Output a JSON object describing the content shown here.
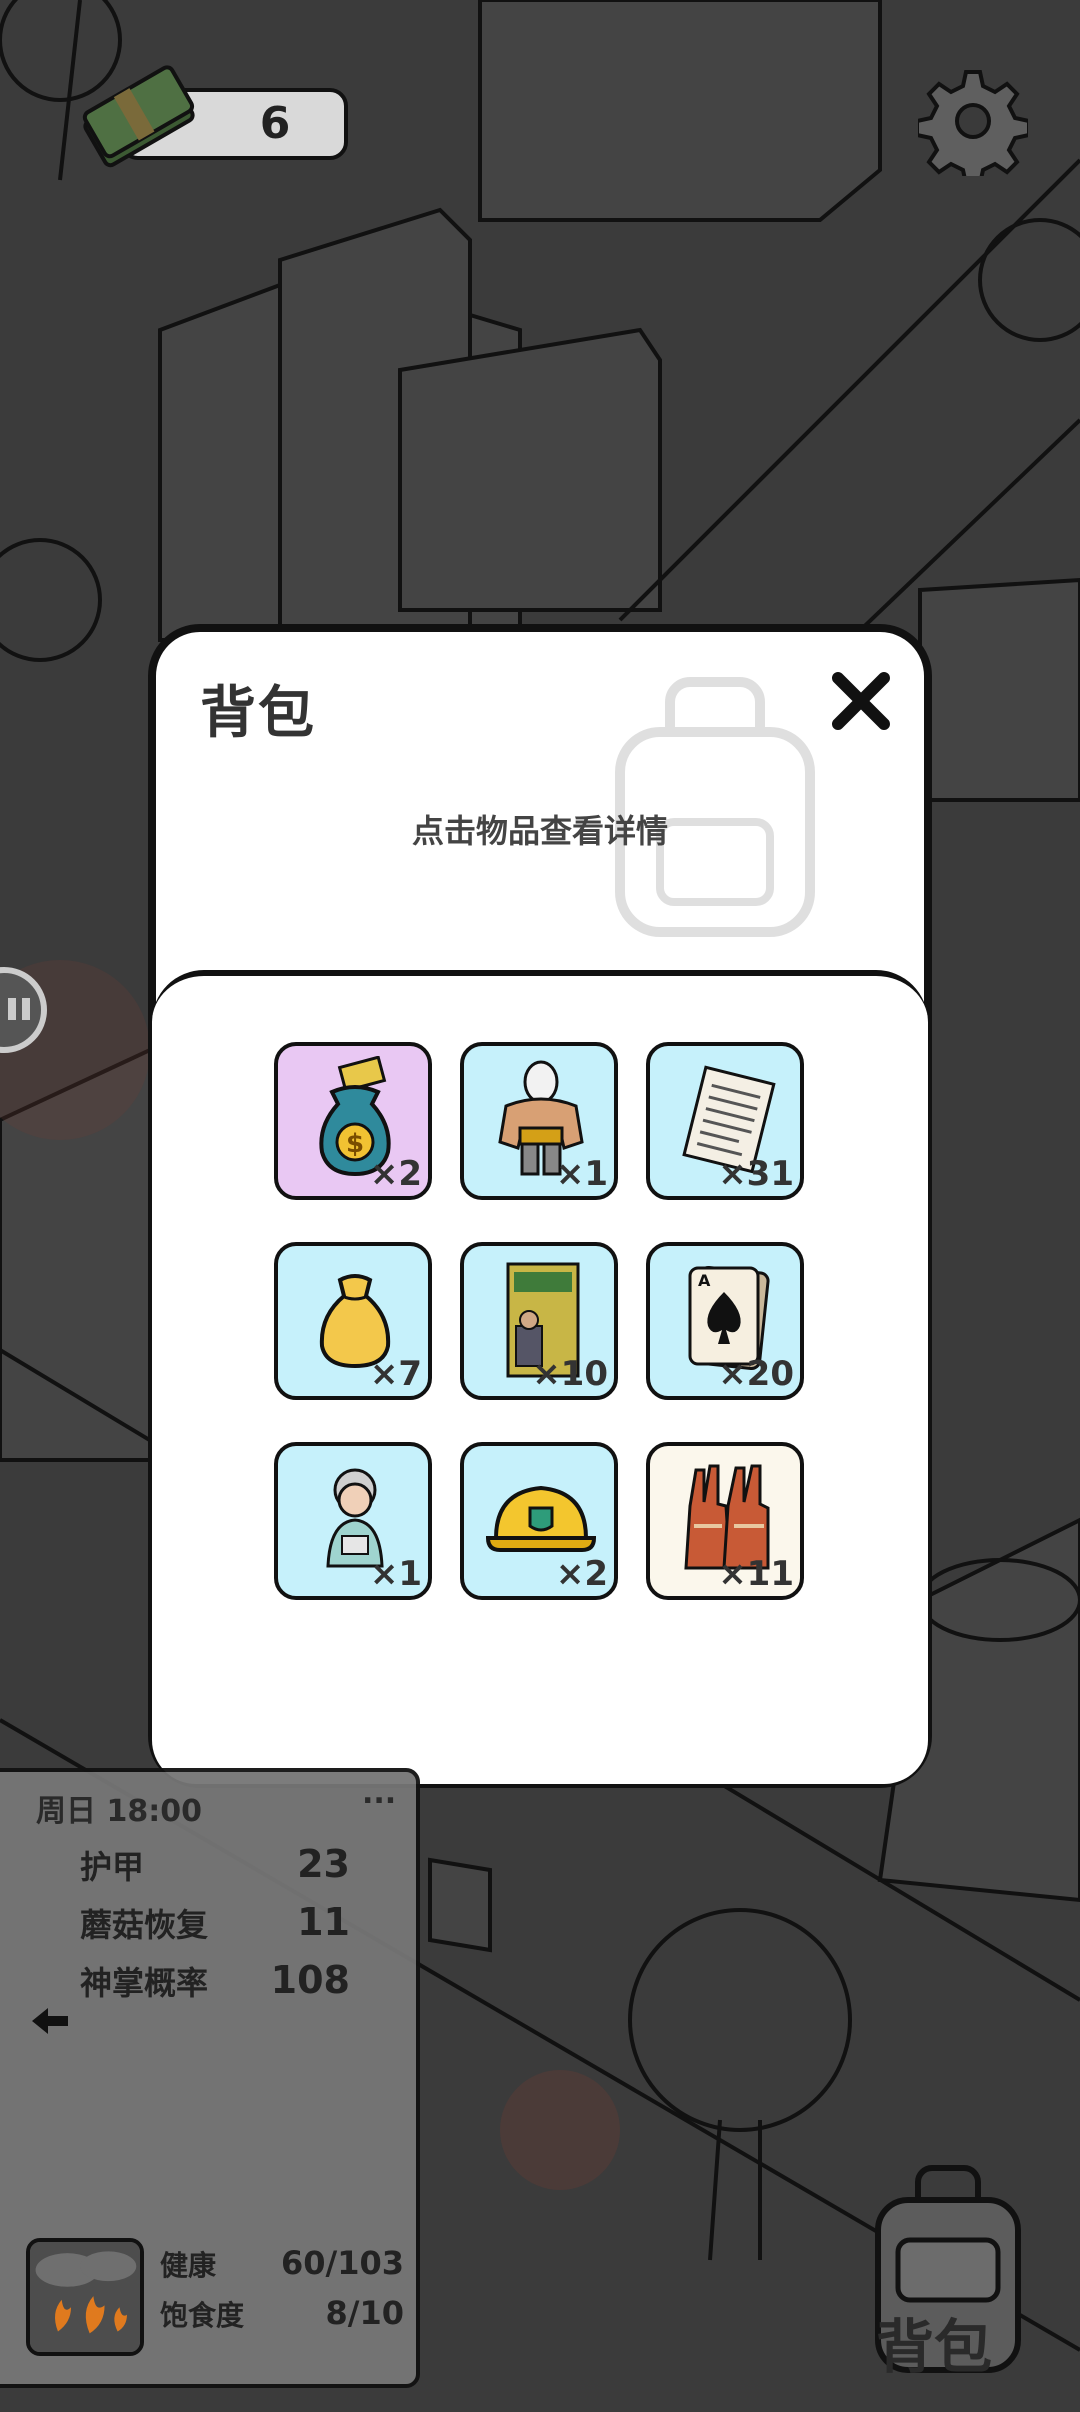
{
  "hud": {
    "money_value": "6",
    "money_icon": "cash-stack-icon",
    "settings_icon": "gear-icon"
  },
  "backpack_modal": {
    "title": "背包",
    "hint": "点击物品查看详情",
    "close_icon": "close-icon",
    "items": [
      {
        "name": "money-bag",
        "icon": "money-bag-icon",
        "count": "×2",
        "bg": "#e9c8f3",
        "selected": true
      },
      {
        "name": "wrestler",
        "icon": "wrestler-icon",
        "count": "×1",
        "bg": "#c6f1fb"
      },
      {
        "name": "document",
        "icon": "document-icon",
        "count": "×31",
        "bg": "#c6f1fb"
      },
      {
        "name": "golden-bag",
        "icon": "golden-bag-icon",
        "count": "×7",
        "bg": "#c6f1fb"
      },
      {
        "name": "book",
        "icon": "book-icon",
        "count": "×10",
        "bg": "#c6f1fb"
      },
      {
        "name": "spade-card",
        "icon": "spade-card-icon",
        "count": "×20",
        "bg": "#c6f1fb"
      },
      {
        "name": "statue",
        "icon": "statue-icon",
        "count": "×1",
        "bg": "#c6f1fb"
      },
      {
        "name": "helmet",
        "icon": "helmet-icon",
        "count": "×2",
        "bg": "#c6f1fb"
      },
      {
        "name": "gloves",
        "icon": "gloves-icon",
        "count": "×11",
        "bg": "#fbf7ec"
      }
    ]
  },
  "stats": {
    "time": "周日 18:00",
    "more": "...",
    "rows": [
      {
        "label": "护甲",
        "value": "23"
      },
      {
        "label": "蘑菇恢复",
        "value": "11"
      },
      {
        "label": "神掌概率",
        "value": "108"
      }
    ],
    "vitals": [
      {
        "label": "健康",
        "value": "60/103"
      },
      {
        "label": "饱食度",
        "value": "8/10"
      }
    ]
  },
  "backpack_button": {
    "label": "背包",
    "icon": "backpack-icon"
  },
  "colors": {
    "slot_blue": "#c6f1fb",
    "slot_selected": "#e9c8f3",
    "dim_overlay": "#3a3a3a"
  }
}
